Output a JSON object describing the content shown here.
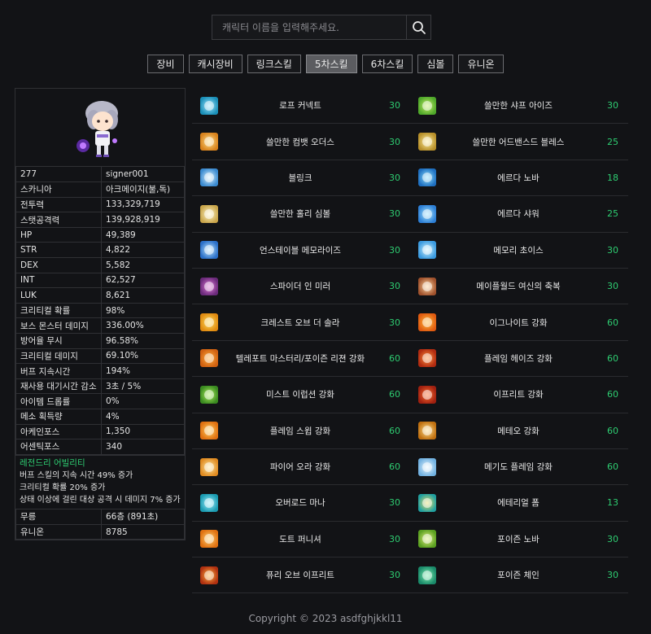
{
  "search": {
    "placeholder": "캐릭터 이름을 입력해주세요."
  },
  "tabs": [
    "장비",
    "캐시장비",
    "링크스킬",
    "5차스킬",
    "6차스킬",
    "심볼",
    "유니온"
  ],
  "active_tab": 3,
  "character": {
    "stats": [
      [
        "277",
        "signer001"
      ],
      [
        "스카니아",
        "아크메이지(불,독)"
      ],
      [
        "전투력",
        "133,329,719"
      ],
      [
        "스탯공격력",
        "139,928,919"
      ],
      [
        "HP",
        "49,389"
      ],
      [
        "STR",
        "4,822"
      ],
      [
        "DEX",
        "5,582"
      ],
      [
        "INT",
        "62,527"
      ],
      [
        "LUK",
        "8,621"
      ],
      [
        "크리티컬 확률",
        "98%"
      ],
      [
        "보스 몬스터 데미지",
        "336.00%"
      ],
      [
        "방어율 무시",
        "96.58%"
      ],
      [
        "크리티컬 데미지",
        "69.10%"
      ],
      [
        "버프 지속시간",
        "194%"
      ],
      [
        "재사용 대기시간 감소",
        "3초 / 5%"
      ],
      [
        "아이템 드롭률",
        "0%"
      ],
      [
        "메소 획득량",
        "4%"
      ],
      [
        "아케인포스",
        "1,350"
      ],
      [
        "어센틱포스",
        "340"
      ]
    ],
    "legendary": {
      "title": "레전드리 어빌리티",
      "lines": [
        "버프 스킬의 지속 시간 49% 증가",
        "크리티컬 확률 20% 증가",
        "상태 이상에 걸린 대상 공격 시 데미지 7% 증가"
      ]
    },
    "extra": [
      [
        "무릉",
        "66층 (891초)"
      ],
      [
        "유니온",
        "8785"
      ]
    ]
  },
  "skills": [
    {
      "name": "로프 커넥트",
      "level": "30",
      "icon": "rope-connect-icon",
      "colors": [
        "#1a8fb8",
        "#9fe6ff"
      ]
    },
    {
      "name": "쓸만한 샤프 아이즈",
      "level": "30",
      "icon": "sharp-eyes-icon",
      "colors": [
        "#4fa82a",
        "#c8f06a"
      ]
    },
    {
      "name": "쓸만한 컴뱃 오더스",
      "level": "30",
      "icon": "combat-orders-icon",
      "colors": [
        "#d9821c",
        "#ffe08a"
      ]
    },
    {
      "name": "쓸만한 어드밴스드 블레스",
      "level": "25",
      "icon": "advanced-bless-icon",
      "colors": [
        "#b8902a",
        "#fff0a0"
      ]
    },
    {
      "name": "블링크",
      "level": "30",
      "icon": "blink-icon",
      "colors": [
        "#3a8ad0",
        "#d9f2ff"
      ]
    },
    {
      "name": "에르다 노바",
      "level": "18",
      "icon": "erda-nova-icon",
      "colors": [
        "#1e6fc0",
        "#8fe0ff"
      ]
    },
    {
      "name": "쓸만한 홀리 심볼",
      "level": "30",
      "icon": "holy-symbol-icon",
      "colors": [
        "#c9a54a",
        "#fff6c8"
      ]
    },
    {
      "name": "에르다 샤워",
      "level": "25",
      "icon": "erda-shower-icon",
      "colors": [
        "#2d7fd6",
        "#a8e8ff"
      ]
    },
    {
      "name": "언스테이블 메모라이즈",
      "level": "30",
      "icon": "unstable-memorize-icon",
      "colors": [
        "#2a6fc8",
        "#bfe8ff"
      ]
    },
    {
      "name": "메모리 초이스",
      "level": "30",
      "icon": "memory-choice-icon",
      "colors": [
        "#3a9ae0",
        "#d0f4ff"
      ]
    },
    {
      "name": "스파이더 인 미러",
      "level": "30",
      "icon": "spider-in-mirror-icon",
      "colors": [
        "#6a2a7a",
        "#e07ad8"
      ]
    },
    {
      "name": "메이플월드 여신의 축복",
      "level": "30",
      "icon": "goddess-blessing-icon",
      "colors": [
        "#a0522d",
        "#ffd6a0"
      ]
    },
    {
      "name": "크레스트 오브 더 솔라",
      "level": "30",
      "icon": "crest-of-solar-icon",
      "colors": [
        "#e08a10",
        "#ffe060"
      ]
    },
    {
      "name": "이그나이트 강화",
      "level": "60",
      "icon": "ignite-icon",
      "colors": [
        "#e05a10",
        "#ffc040"
      ]
    },
    {
      "name": "텔레포트 마스터리/포이즌 리젼 강화",
      "level": "60",
      "icon": "teleport-mastery-icon",
      "colors": [
        "#d06010",
        "#ffb040"
      ]
    },
    {
      "name": "플레임 헤이즈 강화",
      "level": "60",
      "icon": "flame-haze-icon",
      "colors": [
        "#b02a10",
        "#ff9040"
      ]
    },
    {
      "name": "미스트 이럽션 강화",
      "level": "60",
      "icon": "mist-eruption-icon",
      "colors": [
        "#3a8a20",
        "#b0f060"
      ]
    },
    {
      "name": "이프리트 강화",
      "level": "60",
      "icon": "ifrit-icon",
      "colors": [
        "#a02010",
        "#ff7030"
      ]
    },
    {
      "name": "플레임 스윕 강화",
      "level": "60",
      "icon": "flame-sweep-icon",
      "colors": [
        "#e07010",
        "#ffd060"
      ]
    },
    {
      "name": "메테오 강화",
      "level": "60",
      "icon": "meteor-icon",
      "colors": [
        "#c07010",
        "#ffe090"
      ]
    },
    {
      "name": "파이어 오라 강화",
      "level": "60",
      "icon": "fire-aura-icon",
      "colors": [
        "#e08a20",
        "#ffe8a0"
      ]
    },
    {
      "name": "메기도 플레임 강화",
      "level": "60",
      "icon": "megiddo-flame-icon",
      "colors": [
        "#70b0e0",
        "#eaf8ff"
      ]
    },
    {
      "name": "오버로드 마나",
      "level": "30",
      "icon": "overload-mana-icon",
      "colors": [
        "#1a9ab0",
        "#a0f0ff"
      ]
    },
    {
      "name": "에테리얼 폼",
      "level": "13",
      "icon": "ethereal-form-icon",
      "colors": [
        "#20a0a0",
        "#f0e070"
      ]
    },
    {
      "name": "도트 퍼니셔",
      "level": "30",
      "icon": "dot-punisher-icon",
      "colors": [
        "#e07010",
        "#ffd070"
      ]
    },
    {
      "name": "포이즌 노바",
      "level": "30",
      "icon": "poison-nova-icon",
      "colors": [
        "#5aa020",
        "#e0f080"
      ]
    },
    {
      "name": "퓨리 오브 이프리트",
      "level": "30",
      "icon": "fury-of-ifrit-icon",
      "colors": [
        "#b03010",
        "#ffb040"
      ]
    },
    {
      "name": "포이즌 체인",
      "level": "30",
      "icon": "poison-chain-icon",
      "colors": [
        "#1a8a6a",
        "#80f0b0"
      ]
    }
  ],
  "footer": "Copyright © 2023 asdfghjkkl11"
}
